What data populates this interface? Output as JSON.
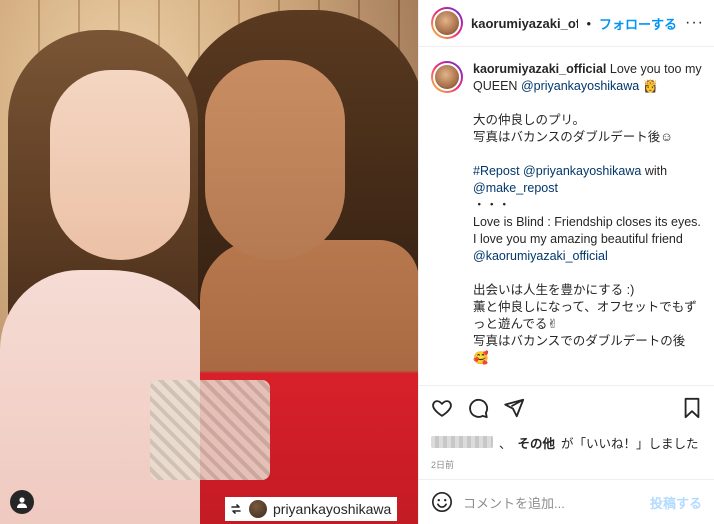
{
  "post": {
    "header": {
      "username": "kaorumiyazaki_offi",
      "separator": "•",
      "follow_label": "フォローする",
      "more_label": "···"
    },
    "caption": {
      "username": "kaorumiyazaki_official",
      "line1": "Love you too my QUEEN",
      "mention1": "@priyankayoshikawa",
      "emoji1": "👸",
      "line2": "大の仲良しのプリ。",
      "line3": "写真はバカンスのダブルデート後☺︎",
      "repost_tag": "#Repost",
      "mention2": "@priyankayoshikawa",
      "with_word": "with",
      "mention3": "@make_repost",
      "dots": "・・・",
      "line4": "Love is Blind : Friendship closes its eyes. I love you my amazing beautiful friend",
      "mention4": "@kaorumiyazaki_official",
      "line5": "出会いは人生を豊かにする :)",
      "line6": "薫と仲良しになって、オフセットでもずっと遊んでる✌︎",
      "line7": "写真はバカンスでのダブルデートの後",
      "emoji2": "🥰"
    },
    "photo": {
      "repost_handle": "priyankayoshikawa"
    },
    "likes": {
      "prefix": "、",
      "others": "その他",
      "suffix": "が「いいね！」しました"
    },
    "timestamp": "2日前",
    "comment": {
      "placeholder": "コメントを追加...",
      "post_label": "投稿する"
    },
    "colors": {
      "accent": "#0095f6",
      "link": "#00376b",
      "muted": "#8e8e8e"
    },
    "icons": [
      "user-tag-icon",
      "repost-icon",
      "heart-icon",
      "comment-icon",
      "share-icon",
      "bookmark-icon",
      "emoji-icon",
      "more-icon"
    ]
  }
}
